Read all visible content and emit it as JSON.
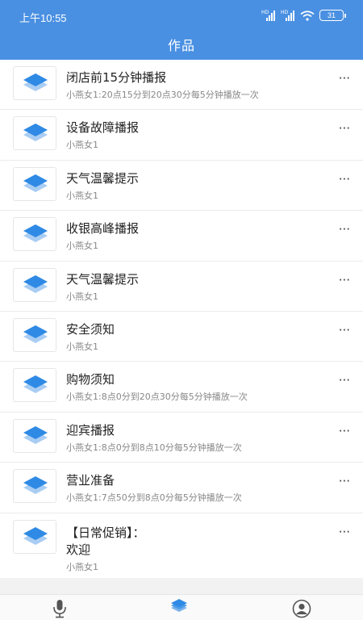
{
  "status": {
    "time": "上午10:55",
    "battery": "31",
    "net1": "HD",
    "net2": "HD"
  },
  "header": {
    "title": "作品"
  },
  "works": [
    {
      "title": "闭店前15分钟播报",
      "subtitle": "小燕女1:20点15分到20点30分每5分钟播放一次"
    },
    {
      "title": "设备故障播报",
      "subtitle": "小燕女1"
    },
    {
      "title": "天气温馨提示",
      "subtitle": "小燕女1"
    },
    {
      "title": "收银高峰播报",
      "subtitle": "小燕女1"
    },
    {
      "title": "天气温馨提示",
      "subtitle": "小燕女1"
    },
    {
      "title": "安全须知",
      "subtitle": "小燕女1"
    },
    {
      "title": "购物须知",
      "subtitle": "小燕女1:8点0分到20点30分每5分钟播放一次"
    },
    {
      "title": "迎宾播报",
      "subtitle": "小燕女1:8点0分到8点10分每5分钟播放一次"
    },
    {
      "title": "营业准备",
      "subtitle": "小燕女1:7点50分到8点0分每5分钟播放一次"
    },
    {
      "title": "【日常促销】：\n欢迎",
      "subtitle": "小燕女1"
    }
  ],
  "more_label": "···",
  "icons": {
    "work": "layers-icon",
    "more": "more-icon",
    "tab_record": "microphone-icon",
    "tab_works": "layers-icon",
    "tab_profile": "user-icon"
  },
  "colors": {
    "header": "#4a90e2",
    "icon_blue": "#2f8ae5",
    "icon_light": "#a9cdf3",
    "tab_active": "#2f8ae5",
    "tab_inactive": "#555555"
  }
}
